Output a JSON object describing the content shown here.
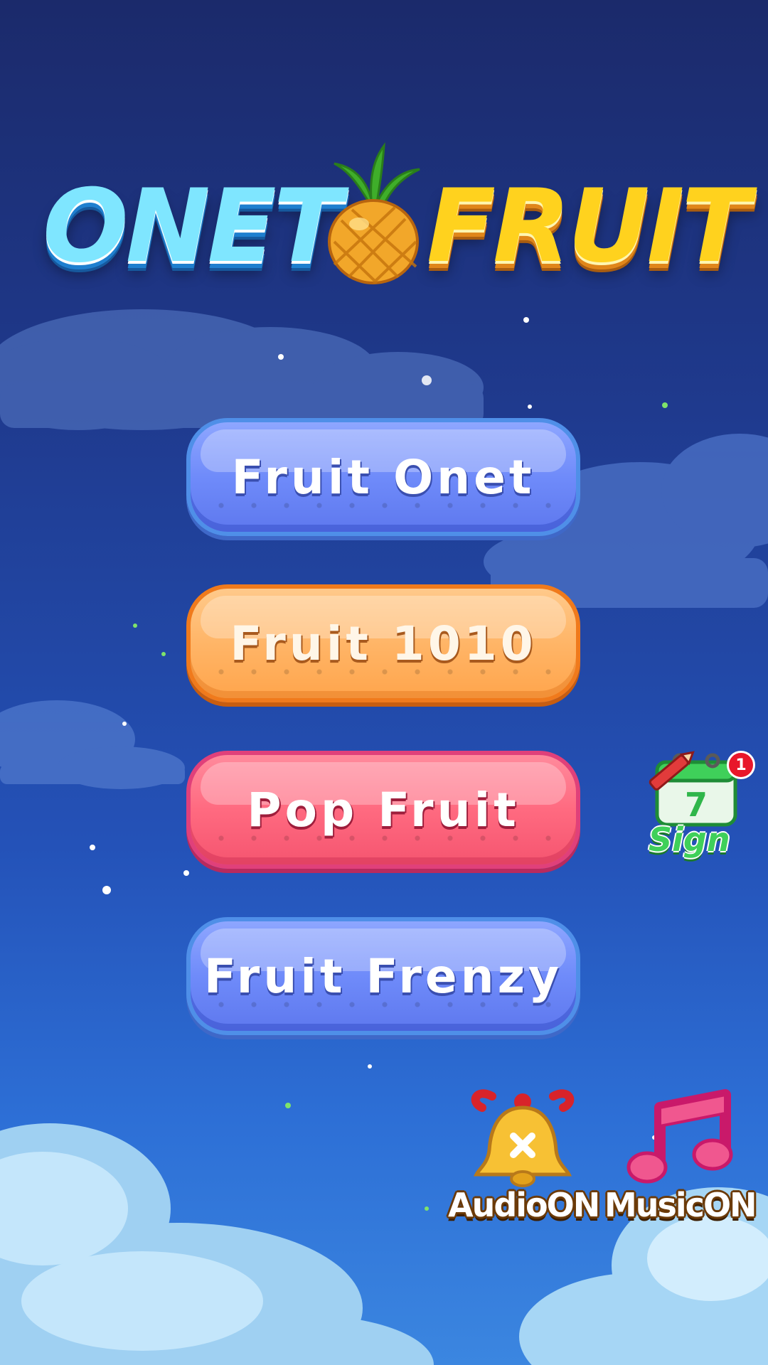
{
  "app": {
    "logo": {
      "left_word": "ONET",
      "right_word": "FRUIT"
    }
  },
  "menu": {
    "modes": [
      {
        "label": "Fruit Onet",
        "color": "#6f8bfa"
      },
      {
        "label": "Fruit 1010",
        "color": "#ffb567"
      },
      {
        "label": "Pop Fruit",
        "color": "#ff6a80"
      },
      {
        "label": "Fruit Frenzy",
        "color": "#6f8bfa"
      }
    ]
  },
  "sign": {
    "label": "Sign",
    "badge_count": "1",
    "calendar_day": "7",
    "icon": "calendar-pencil-icon"
  },
  "settings": {
    "audio": {
      "label": "AudioON",
      "icon": "bell-icon"
    },
    "music": {
      "label": "MusicON",
      "icon": "music-note-icon"
    }
  },
  "colors": {
    "sky_top": "#1b2a6b",
    "sky_bottom": "#3b86e0",
    "accent_green": "#3fd05a",
    "badge_red": "#e8172a"
  }
}
